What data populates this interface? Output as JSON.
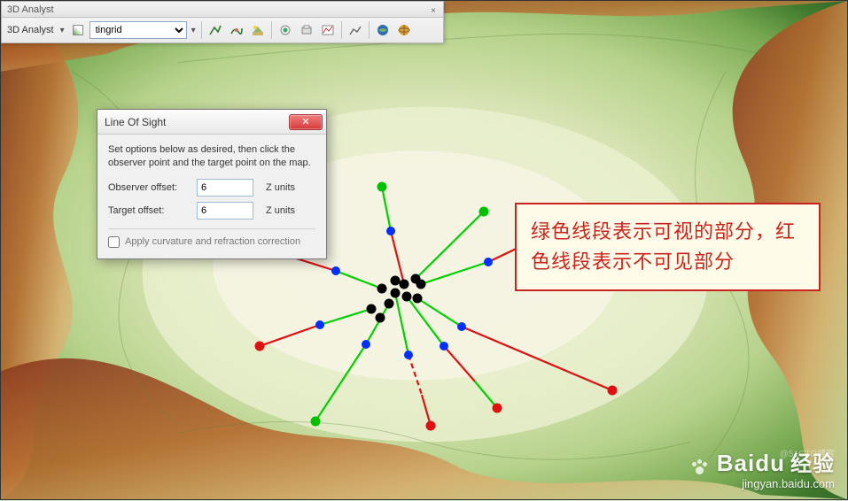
{
  "toolbar": {
    "title": "3D Analyst",
    "dropdown_label": "3D Analyst",
    "layer_value": "tingrid",
    "tools": [
      {
        "name": "interpolate-line-icon"
      },
      {
        "name": "surface-analysis-icon"
      },
      {
        "name": "line-of-sight-icon"
      },
      {
        "name": "point-tool-icon"
      },
      {
        "name": "print-tool-icon"
      },
      {
        "name": "profile-graph-icon"
      },
      {
        "name": "chart-icon"
      },
      {
        "name": "arcscene-icon"
      },
      {
        "name": "arcglobe-icon"
      }
    ]
  },
  "dialog": {
    "title": "Line Of Sight",
    "instruction": "Set options below as desired, then click the observer point and the target point on the map.",
    "observer_label": "Observer offset:",
    "observer_value": "6",
    "target_label": "Target offset:",
    "target_value": "6",
    "units_label": "Z units",
    "checkbox_label": "Apply curvature and refraction correction",
    "checkbox_checked": false
  },
  "annotation": {
    "text": "绿色线段表示可视的部分，红色线段表示不可见部分"
  },
  "watermark": {
    "brand_en": "Baidu",
    "brand_cn": "经验",
    "url": "jingyan.baidu.com",
    "credit": "@51CTO博客"
  },
  "colors": {
    "anno_bg": "#fffbe9",
    "anno_border": "#c9231d",
    "visible_line": "#00d000",
    "hidden_line": "#e01010",
    "obstruction_pt": "#0030ff",
    "observer_pt": "#000000",
    "target_pt_green": "#00c000",
    "target_pt_red": "#e01010"
  },
  "chart_data": {
    "type": "los_diagram",
    "description": "Line-of-sight rays from clustered observers on terrain; green=visible, red=obscured, blue=obstruction, black=observer/intermediate",
    "observers_cluster": [
      [
        445,
        316
      ],
      [
        455,
        320
      ],
      [
        468,
        314
      ],
      [
        474,
        320
      ],
      [
        430,
        325
      ],
      [
        445,
        330
      ],
      [
        458,
        334
      ],
      [
        470,
        336
      ],
      [
        438,
        342
      ],
      [
        418,
        348
      ],
      [
        428,
        358
      ]
    ],
    "rays": [
      {
        "from": [
          455,
          320
        ],
        "to": [
          430,
          210
        ],
        "segments": [
          {
            "to": [
              440,
              260
            ],
            "vis": "red"
          },
          {
            "to": [
              430,
              210
            ],
            "vis": "green"
          }
        ],
        "target": "green"
      },
      {
        "from": [
          468,
          314
        ],
        "to": [
          545,
          238
        ],
        "segments": [
          {
            "to": [
              545,
              238
            ],
            "vis": "green"
          }
        ],
        "target": "green"
      },
      {
        "from": [
          474,
          320
        ],
        "to": [
          640,
          252
        ],
        "segments": [
          {
            "to": [
              550,
              295
            ],
            "vis": "green"
          },
          {
            "to": [
              640,
              252
            ],
            "vis": "red"
          }
        ],
        "obstruction": [
          550,
          295
        ],
        "target": "red"
      },
      {
        "from": [
          470,
          336
        ],
        "to": [
          690,
          440
        ],
        "segments": [
          {
            "to": [
              520,
              368
            ],
            "vis": "green"
          },
          {
            "to": [
              690,
              440
            ],
            "vis": "red"
          }
        ],
        "obstruction": [
          520,
          368
        ],
        "target": "red"
      },
      {
        "from": [
          458,
          334
        ],
        "to": [
          560,
          460
        ],
        "segments": [
          {
            "to": [
              500,
              390
            ],
            "vis": "green"
          },
          {
            "to": [
              535,
              430
            ],
            "vis": "red"
          },
          {
            "to": [
              560,
              460
            ],
            "vis": "green"
          }
        ],
        "obstruction": [
          500,
          390
        ],
        "target": "red"
      },
      {
        "from": [
          445,
          330
        ],
        "to": [
          485,
          480
        ],
        "segments": [
          {
            "to": [
              460,
              400
            ],
            "vis": "green"
          },
          {
            "to": [
              475,
              445
            ],
            "vis": "red"
          },
          {
            "to": [
              485,
              480
            ],
            "vis": "red"
          }
        ],
        "obstruction": [
          460,
          400
        ],
        "target": "red"
      },
      {
        "from": [
          438,
          342
        ],
        "to": [
          355,
          475
        ],
        "segments": [
          {
            "to": [
              412,
              388
            ],
            "vis": "green"
          },
          {
            "to": [
              355,
              475
            ],
            "vis": "green"
          }
        ],
        "obstruction": [
          412,
          388
        ],
        "target": "green"
      },
      {
        "from": [
          418,
          348
        ],
        "to": [
          292,
          390
        ],
        "segments": [
          {
            "to": [
              360,
              366
            ],
            "vis": "green"
          },
          {
            "to": [
              292,
              390
            ],
            "vis": "red"
          }
        ],
        "obstruction": [
          360,
          366
        ],
        "target": "red"
      },
      {
        "from": [
          430,
          325
        ],
        "to": [
          292,
          278
        ],
        "segments": [
          {
            "to": [
              378,
              305
            ],
            "vis": "green"
          },
          {
            "to": [
              292,
              278
            ],
            "vis": "red"
          }
        ],
        "obstruction": [
          378,
          305
        ],
        "target": "red"
      }
    ]
  }
}
